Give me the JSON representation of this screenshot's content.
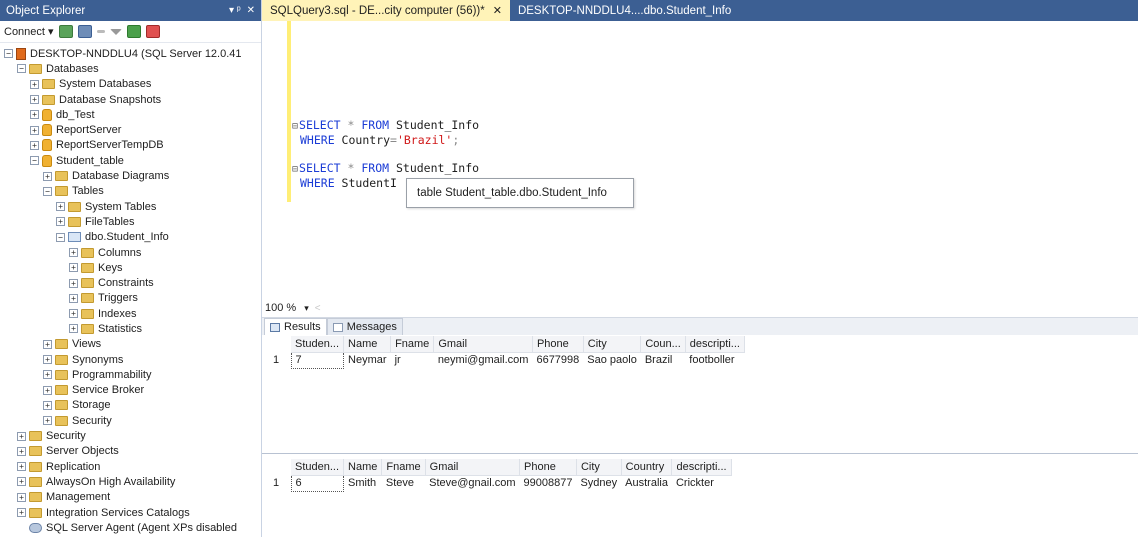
{
  "object_explorer": {
    "title": "Object Explorer",
    "pin_glyph": "▾ ᵖ",
    "close_glyph": "✕",
    "connect_label": "Connect ▾",
    "tree": [
      {
        "label": "DESKTOP-NNDDLU4 (SQL Server 12.0.41",
        "depth": 0,
        "expander": "−",
        "icon": "server"
      },
      {
        "label": "Databases",
        "depth": 1,
        "expander": "−",
        "icon": "folder"
      },
      {
        "label": "System Databases",
        "depth": 2,
        "expander": "+",
        "icon": "folder"
      },
      {
        "label": "Database Snapshots",
        "depth": 2,
        "expander": "+",
        "icon": "folder"
      },
      {
        "label": "db_Test",
        "depth": 2,
        "expander": "+",
        "icon": "db"
      },
      {
        "label": "ReportServer",
        "depth": 2,
        "expander": "+",
        "icon": "db"
      },
      {
        "label": "ReportServerTempDB",
        "depth": 2,
        "expander": "+",
        "icon": "db"
      },
      {
        "label": "Student_table",
        "depth": 2,
        "expander": "−",
        "icon": "db"
      },
      {
        "label": "Database Diagrams",
        "depth": 3,
        "expander": "+",
        "icon": "folder"
      },
      {
        "label": "Tables",
        "depth": 3,
        "expander": "−",
        "icon": "folder"
      },
      {
        "label": "System Tables",
        "depth": 4,
        "expander": "+",
        "icon": "folder"
      },
      {
        "label": "FileTables",
        "depth": 4,
        "expander": "+",
        "icon": "folder"
      },
      {
        "label": "dbo.Student_Info",
        "depth": 4,
        "expander": "−",
        "icon": "table"
      },
      {
        "label": "Columns",
        "depth": 5,
        "expander": "+",
        "icon": "folder"
      },
      {
        "label": "Keys",
        "depth": 5,
        "expander": "+",
        "icon": "folder"
      },
      {
        "label": "Constraints",
        "depth": 5,
        "expander": "+",
        "icon": "folder"
      },
      {
        "label": "Triggers",
        "depth": 5,
        "expander": "+",
        "icon": "folder"
      },
      {
        "label": "Indexes",
        "depth": 5,
        "expander": "+",
        "icon": "folder"
      },
      {
        "label": "Statistics",
        "depth": 5,
        "expander": "+",
        "icon": "folder"
      },
      {
        "label": "Views",
        "depth": 3,
        "expander": "+",
        "icon": "folder"
      },
      {
        "label": "Synonyms",
        "depth": 3,
        "expander": "+",
        "icon": "folder"
      },
      {
        "label": "Programmability",
        "depth": 3,
        "expander": "+",
        "icon": "folder"
      },
      {
        "label": "Service Broker",
        "depth": 3,
        "expander": "+",
        "icon": "folder"
      },
      {
        "label": "Storage",
        "depth": 3,
        "expander": "+",
        "icon": "folder"
      },
      {
        "label": "Security",
        "depth": 3,
        "expander": "+",
        "icon": "folder"
      },
      {
        "label": "Security",
        "depth": 1,
        "expander": "+",
        "icon": "folder"
      },
      {
        "label": "Server Objects",
        "depth": 1,
        "expander": "+",
        "icon": "folder"
      },
      {
        "label": "Replication",
        "depth": 1,
        "expander": "+",
        "icon": "folder"
      },
      {
        "label": "AlwaysOn High Availability",
        "depth": 1,
        "expander": "+",
        "icon": "folder"
      },
      {
        "label": "Management",
        "depth": 1,
        "expander": "+",
        "icon": "folder"
      },
      {
        "label": "Integration Services Catalogs",
        "depth": 1,
        "expander": "+",
        "icon": "folder"
      },
      {
        "label": "SQL Server Agent (Agent XPs disabled",
        "depth": 1,
        "expander": "",
        "icon": "agent"
      }
    ]
  },
  "tabs": [
    {
      "label": "SQLQuery3.sql - DE...city computer (56))*",
      "close": "✕",
      "active": true
    },
    {
      "label": "DESKTOP-NNDDLU4....dbo.Student_Info",
      "close": "",
      "active": false
    }
  ],
  "editor": {
    "q1_kw1": "SELECT",
    "q1_star": " * ",
    "q1_kw2": "FROM",
    "q1_table": " Student_Info",
    "q1_where": "WHERE",
    "q1_col": " Country",
    "q1_eq": "=",
    "q1_val": "'Brazil'",
    "q1_semi": ";",
    "q2_kw1": "SELECT",
    "q2_star": " * ",
    "q2_kw2": "FROM",
    "q2_table": " Student_Info",
    "q2_where": "WHERE",
    "q2_col": " StudentI",
    "tooltip": "table Student_table.dbo.Student_Info"
  },
  "zoom": {
    "value": "100 %",
    "caret": "▾",
    "arrow": "<"
  },
  "result_tabs": [
    {
      "label": "Results",
      "active": true
    },
    {
      "label": "Messages",
      "active": false
    }
  ],
  "result1": {
    "columns": [
      "Studen...",
      "Name",
      "Fname",
      "Gmail",
      "Phone",
      "City",
      "Coun...",
      "descripti..."
    ],
    "rows": [
      {
        "rownum": "1",
        "cells": [
          "7",
          "Neymar",
          "jr",
          "neymi@gmail.com",
          "6677998",
          "Sao paolo",
          "Brazil",
          "footboller"
        ]
      }
    ]
  },
  "result2": {
    "columns": [
      "Studen...",
      "Name",
      "Fname",
      "Gmail",
      "Phone",
      "City",
      "Country",
      "descripti..."
    ],
    "rows": [
      {
        "rownum": "1",
        "cells": [
          "6",
          "Smith",
          "Steve",
          "Steve@gnail.com",
          "99008877",
          "Sydney",
          "Australia",
          "Crickter"
        ]
      }
    ]
  }
}
